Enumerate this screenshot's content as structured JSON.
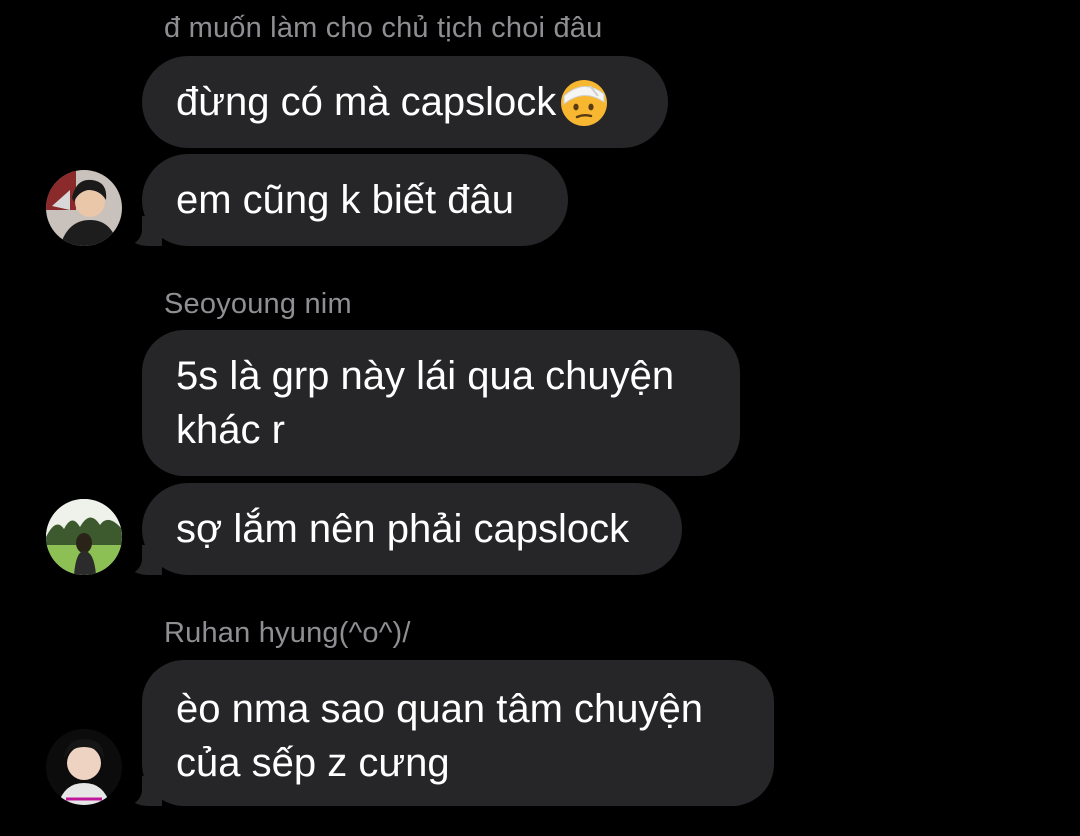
{
  "messages": [
    {
      "sender_top": "đ muốn làm cho chủ tịch choi đâu",
      "bubble1": "đừng có mà capslock",
      "bubble1_emoji": "face-with-head-bandage-emoji",
      "bubble2": "em cũng k biết đâu"
    },
    {
      "sender": "Seoyoung nim",
      "bubble1": "5s là grp này lái qua chuyện\nkhác r",
      "bubble2": "sợ lắm nên phải capslock"
    },
    {
      "sender": "Ruhan hyung(^o^)/",
      "bubble1": "èo nma sao quan tâm chuyện\ncủa sếp z cưng"
    }
  ],
  "colors": {
    "background": "#000000",
    "bubble": "#262628",
    "sender_name": "#8e8e93",
    "text": "#ffffff"
  }
}
